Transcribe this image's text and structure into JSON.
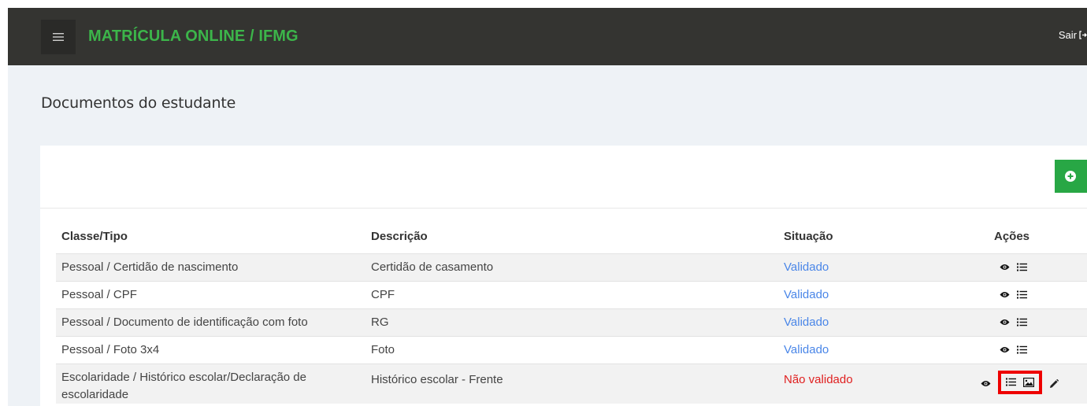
{
  "app": {
    "title": "MATRÍCULA ONLINE / IFMG",
    "logout_label": "Sair"
  },
  "page": {
    "title": "Documentos do estudante"
  },
  "table": {
    "headers": [
      "Classe/Tipo",
      "Descrição",
      "Situação",
      "Ações"
    ],
    "rows": [
      {
        "classe": "Pessoal / Certidão de nascimento",
        "descricao": "Certidão de casamento",
        "situacao": "Validado"
      },
      {
        "classe": "Pessoal / CPF",
        "descricao": "CPF",
        "situacao": "Validado"
      },
      {
        "classe": "Pessoal / Documento de identificação com foto",
        "descricao": "RG",
        "situacao": "Validado"
      },
      {
        "classe": "Pessoal / Foto 3x4",
        "descricao": "Foto",
        "situacao": "Validado"
      },
      {
        "classe": "Escolaridade / Histórico escolar/Declaração de escolaridade",
        "descricao": "Histórico escolar - Frente",
        "situacao": "Não validado"
      }
    ]
  },
  "icons": {
    "menu": "hamburger-icon",
    "logout": "logout-icon",
    "add": "plus-circle-icon",
    "view": "eye-icon",
    "list": "list-icon",
    "image": "image-icon",
    "edit": "pencil-icon"
  },
  "colors": {
    "navbar": "#343431",
    "brand": "#3cb54a",
    "add_button": "#28a745",
    "validated": "#4a86e8",
    "not_validated": "#e02020",
    "highlight": "#ee0000"
  }
}
